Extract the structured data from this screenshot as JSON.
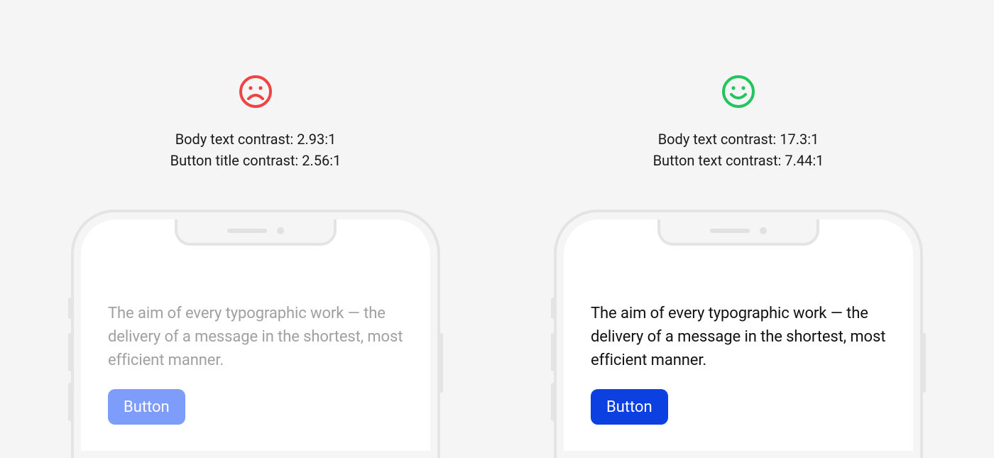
{
  "bad": {
    "face": "sad",
    "face_color": "#ef4444",
    "body_contrast_label": "Body text contrast: 2.93:1",
    "button_contrast_label": "Button title contrast: 2.56:1",
    "body_text": "The aim of every typographic work — the delivery of a message in the shortest, most efficient manner.",
    "button_label": "Button",
    "body_text_color": "#a0a0a0",
    "button_bg": "#7e9cf9"
  },
  "good": {
    "face": "happy",
    "face_color": "#22c55e",
    "body_contrast_label": "Body text contrast: 17.3:1",
    "button_contrast_label": "Button text contrast: 7.44:1",
    "body_text": "The aim of every typographic work — the delivery of a message in the shortest, most efficient manner.",
    "button_label": "Button",
    "body_text_color": "#111111",
    "button_bg": "#0c40e0"
  }
}
